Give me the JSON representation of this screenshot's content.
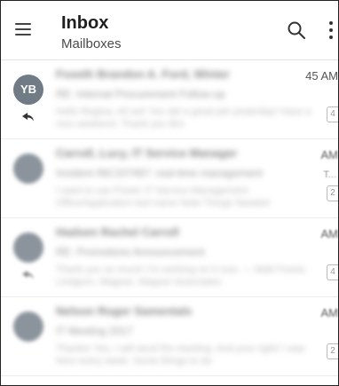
{
  "header": {
    "title": "Inbox",
    "subtitle": "Mailboxes",
    "icons": {
      "menu": "hamburger-menu-icon",
      "search": "search-icon",
      "overflow": "more-vertical-icon"
    }
  },
  "messages": [
    {
      "avatar": "YB",
      "sender": "Foseth Brandon A. Ford, Winter",
      "subject": "RE: Internal Procurement Follow-up",
      "preview": "Hello Regina, All set! You did a great job yesterday! Have a nice weekend. Thank you Bro",
      "time": "45 AM",
      "count": "4",
      "replied": true
    },
    {
      "avatar": "",
      "sender": "Carroll, Lucy, IT Service Manager",
      "subject": "Incident INC107467: real-time management",
      "preview": "I want to use Power IT Service Management. Office/Application tool name Note Things Needed",
      "time": "AM",
      "count": "2",
      "marker": "T...",
      "replied": false
    },
    {
      "avatar": "",
      "sender": "Hadsen Rachel Carroll",
      "subject": "RE: Promotions Announcement",
      "preview": "Thank you so much! I'm working on it now. — Matt Forest, Lindgren, Wagner, Wagner Associates",
      "time": "AM",
      "count": "4",
      "replied": true
    },
    {
      "avatar": "",
      "sender": "Nelson Roger Samentals",
      "subject": "IT Meeting 2017",
      "preview": "Thanks! Yes, I will send the meeting. And your right! I was here every week. Some things to do",
      "time": "AM",
      "count": "2",
      "replied": false
    }
  ]
}
